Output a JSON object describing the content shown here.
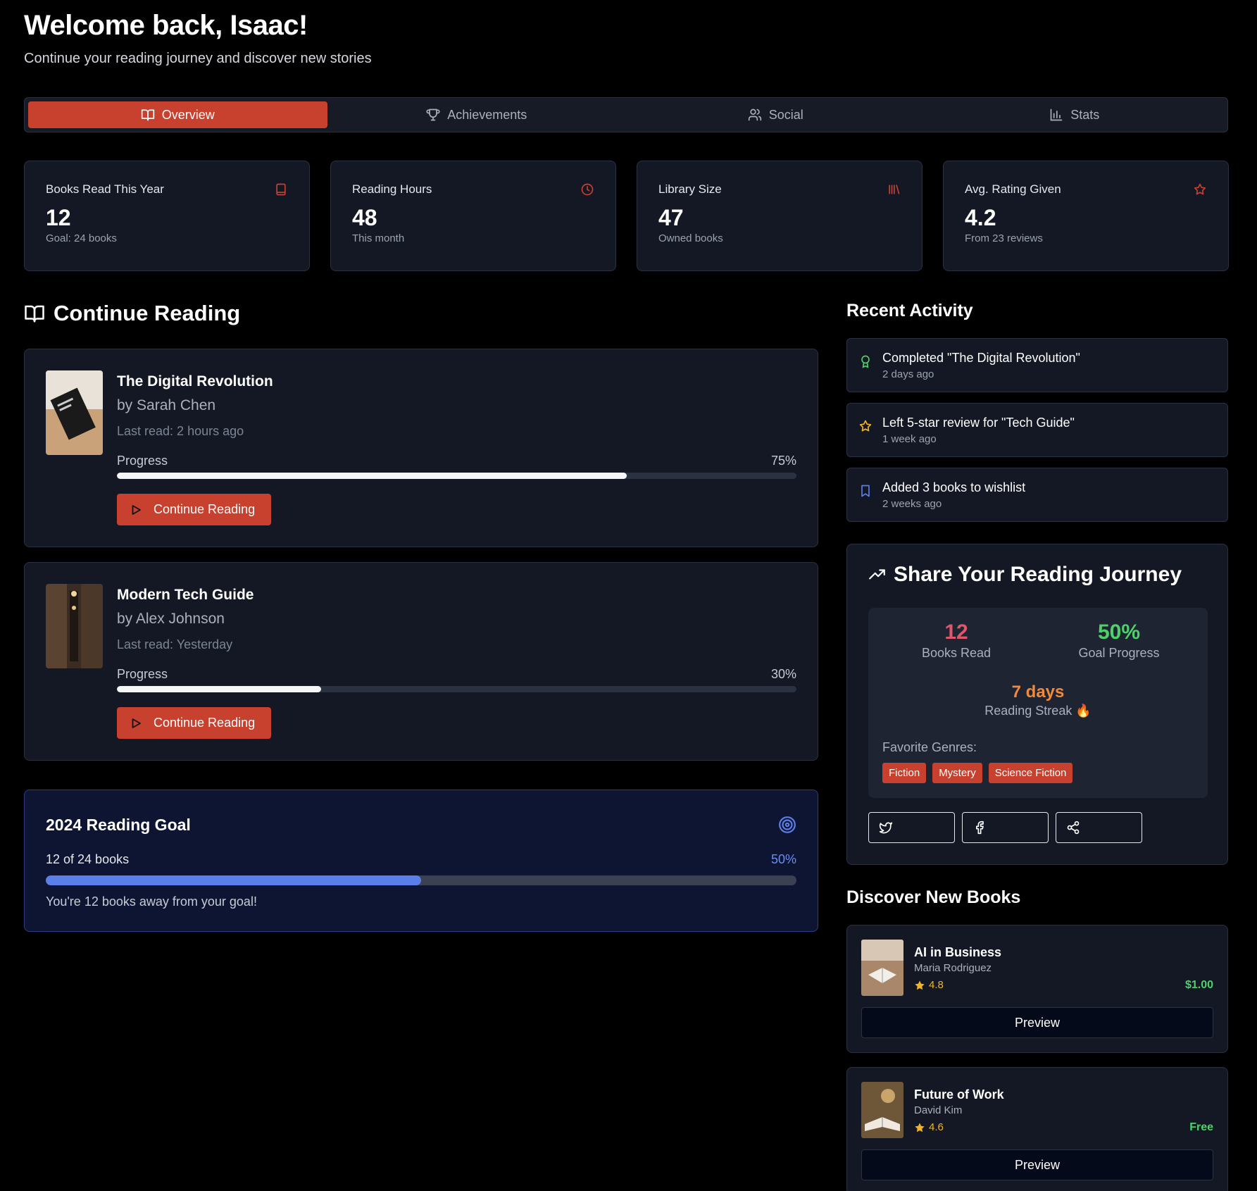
{
  "header": {
    "title": "Welcome back, Isaac!",
    "subtitle": "Continue your reading journey and discover new stories"
  },
  "tabs": [
    {
      "label": "Overview",
      "icon": "book-open-icon",
      "active": true
    },
    {
      "label": "Achievements",
      "icon": "trophy-icon",
      "active": false
    },
    {
      "label": "Social",
      "icon": "users-icon",
      "active": false
    },
    {
      "label": "Stats",
      "icon": "bar-chart-icon",
      "active": false
    }
  ],
  "stats": [
    {
      "label": "Books Read This Year",
      "value": "12",
      "sub": "Goal: 24 books",
      "icon": "book-icon"
    },
    {
      "label": "Reading Hours",
      "value": "48",
      "sub": "This month",
      "icon": "clock-icon"
    },
    {
      "label": "Library Size",
      "value": "47",
      "sub": "Owned books",
      "icon": "library-icon"
    },
    {
      "label": "Avg. Rating Given",
      "value": "4.2",
      "sub": "From 23 reviews",
      "icon": "star-icon"
    }
  ],
  "continue_reading": {
    "heading": "Continue Reading",
    "progress_label": "Progress",
    "button_label": "Continue Reading",
    "books": [
      {
        "title": "The Digital Revolution",
        "author": "by Sarah Chen",
        "last_read": "Last read: 2 hours ago",
        "progress_text": "75%",
        "progress": 0.75
      },
      {
        "title": "Modern Tech Guide",
        "author": "by Alex Johnson",
        "last_read": "Last read: Yesterday",
        "progress_text": "30%",
        "progress": 0.3
      }
    ]
  },
  "goal": {
    "title": "2024 Reading Goal",
    "summary": "12 of 24 books",
    "percent_text": "50%",
    "progress": 0.5,
    "message": "You're 12 books away from your goal!"
  },
  "activity": {
    "heading": "Recent Activity",
    "items": [
      {
        "text": "Completed \"The Digital Revolution\"",
        "time": "2 days ago",
        "icon": "award-icon"
      },
      {
        "text": "Left 5-star review for \"Tech Guide\"",
        "time": "1 week ago",
        "icon": "star-icon"
      },
      {
        "text": "Added 3 books to wishlist",
        "time": "2 weeks ago",
        "icon": "bookmark-icon"
      }
    ]
  },
  "share": {
    "heading": "Share Your Reading Journey",
    "books_read": {
      "value": "12",
      "label": "Books Read"
    },
    "goal_progress": {
      "value": "50%",
      "label": "Goal Progress"
    },
    "streak": {
      "value": "7 days",
      "label": "Reading Streak 🔥"
    },
    "genres_label": "Favorite Genres:",
    "genres": [
      "Fiction",
      "Mystery",
      "Science Fiction"
    ]
  },
  "discover": {
    "heading": "Discover New Books",
    "preview_label": "Preview",
    "books": [
      {
        "title": "AI in Business",
        "author": "Maria Rodriguez",
        "rating": "4.8",
        "price": "$1.00"
      },
      {
        "title": "Future of Work",
        "author": "David Kim",
        "rating": "4.6",
        "price": "Free"
      }
    ]
  },
  "colors": {
    "accent": "#c8412f",
    "goal_blue": "#5b7fe8",
    "success_green": "#4fd06b",
    "streak_orange": "#f08a3c",
    "books_red": "#e0566a"
  }
}
